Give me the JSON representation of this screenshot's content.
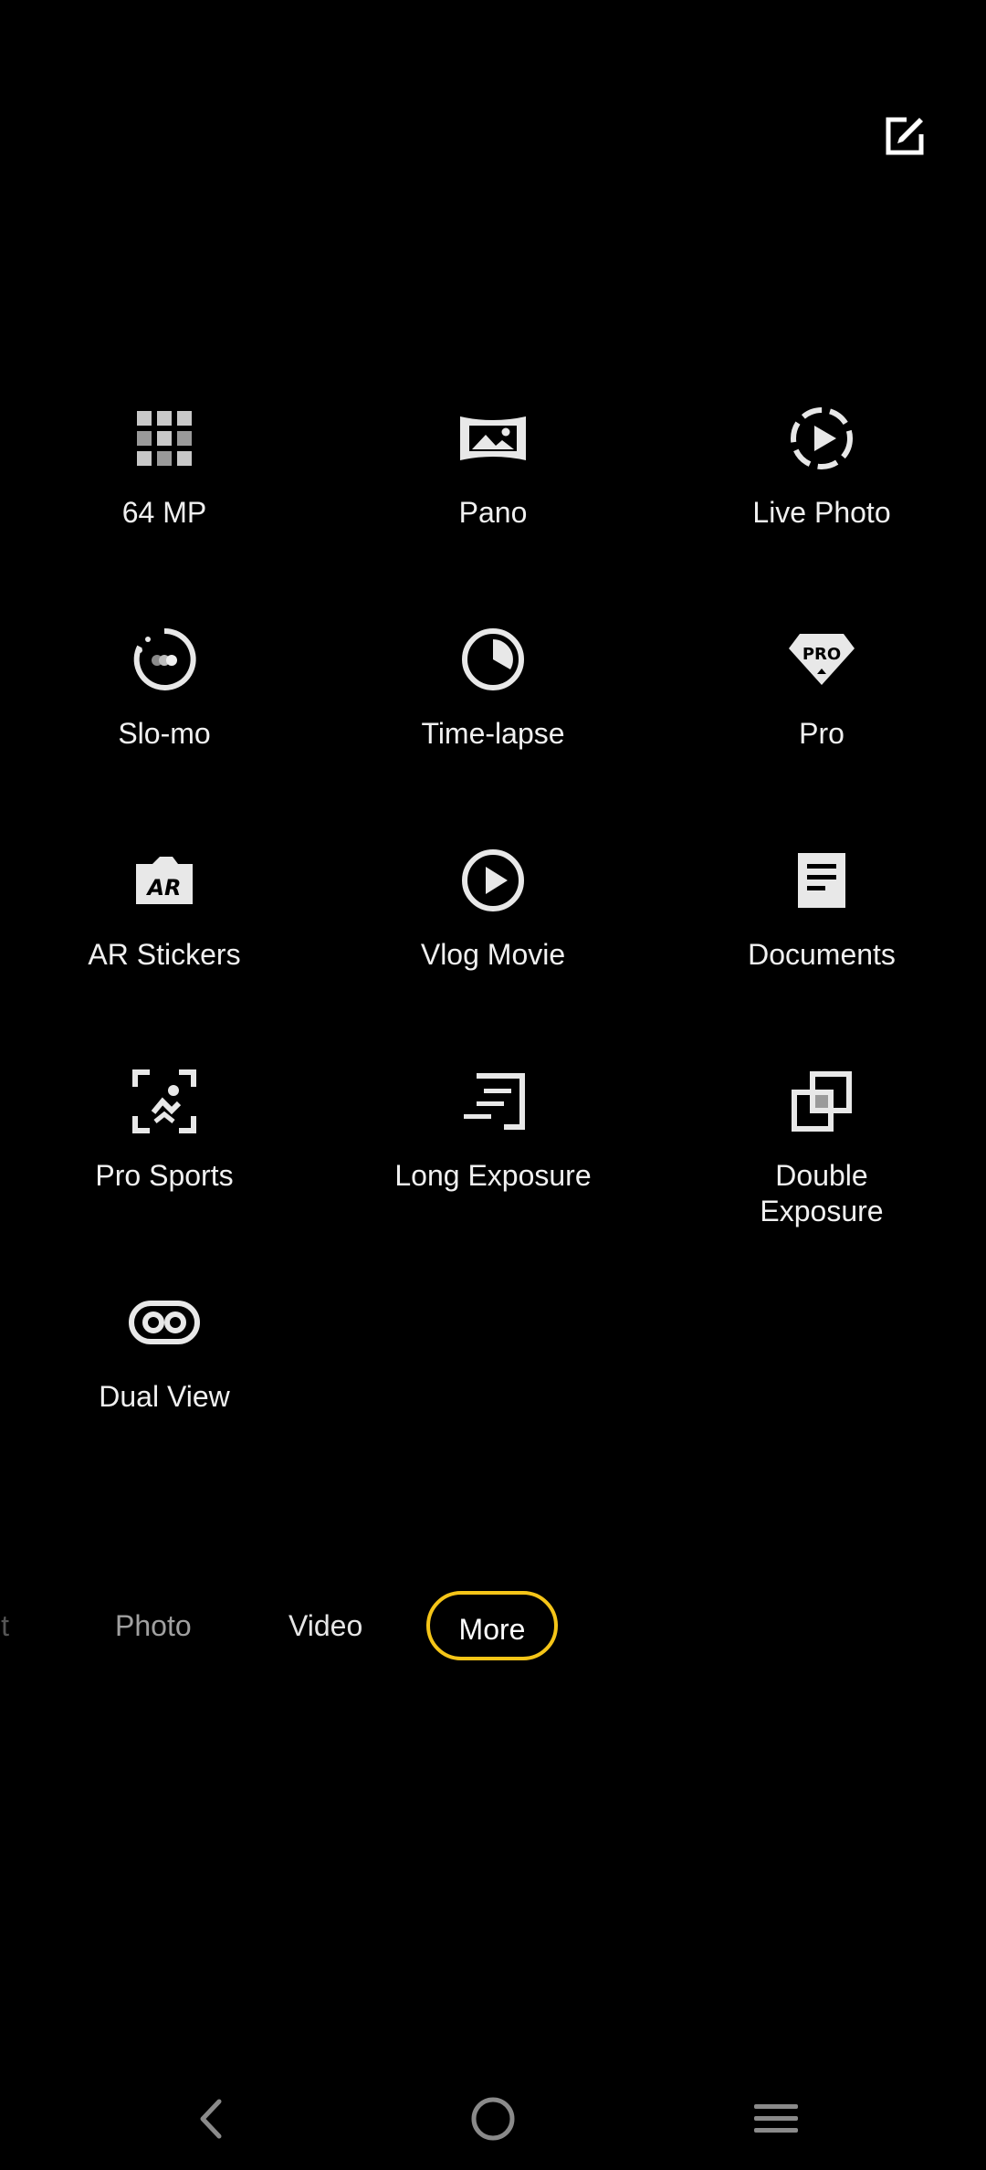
{
  "icons": {
    "edit": "edit-icon",
    "back": "back-icon",
    "home": "home-icon",
    "recents": "recents-icon"
  },
  "colors": {
    "accent": "#f5c518",
    "background": "#000000"
  },
  "modes": [
    {
      "label": "64 MP",
      "icon": "grid-64mp-icon"
    },
    {
      "label": "Pano",
      "icon": "panorama-icon"
    },
    {
      "label": "Live Photo",
      "icon": "live-photo-icon"
    },
    {
      "label": "Slo-mo",
      "icon": "slow-motion-icon"
    },
    {
      "label": "Time-lapse",
      "icon": "timelapse-icon"
    },
    {
      "label": "Pro",
      "icon": "pro-badge-icon"
    },
    {
      "label": "AR Stickers",
      "icon": "ar-stickers-icon"
    },
    {
      "label": "Vlog Movie",
      "icon": "vlog-play-icon"
    },
    {
      "label": "Documents",
      "icon": "document-icon"
    },
    {
      "label": "Pro Sports",
      "icon": "pro-sports-icon"
    },
    {
      "label": "Long Exposure",
      "icon": "long-exposure-icon"
    },
    {
      "label": "Double\nExposure",
      "icon": "double-exposure-icon"
    },
    {
      "label": "Dual View",
      "icon": "dual-view-icon"
    }
  ],
  "mode_switcher": {
    "cut_label": "it",
    "photo": "Photo",
    "video": "Video",
    "more": "More"
  }
}
